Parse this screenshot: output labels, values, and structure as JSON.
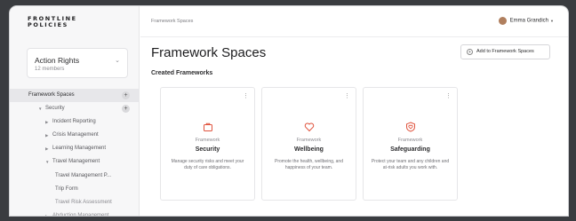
{
  "brand": {
    "logo_line1": "FRONTLINE",
    "logo_line2": "POLICIES"
  },
  "org": {
    "name": "Action Rights",
    "members": "12 members"
  },
  "tree": {
    "framework_spaces": "Framework Spaces",
    "security": "Security",
    "incident_reporting": "Incident Reporting",
    "crisis_management": "Crisis Management",
    "learning_management": "Learning Management",
    "travel_management": "Travel Management",
    "travel_management_p": "Travel Management P...",
    "trip_form": "Trip Form",
    "travel_risk_assessment": "Travel Risk Assessment",
    "abduction_management": "Abduction Management"
  },
  "header": {
    "breadcrumb": "Framework Spaces",
    "user_name": "Emma Grandich"
  },
  "main": {
    "title": "Framework Spaces",
    "add_button": "Add to Framework Spaces",
    "section_title": "Created Frameworks"
  },
  "cards": [
    {
      "kind": "Framework",
      "name": "Security",
      "desc": "Manage security risks and meet your duty of care obligations.",
      "icon": "briefcase-icon"
    },
    {
      "kind": "Framework",
      "name": "Wellbeing",
      "desc": "Promote the health, wellbeing, and happiness of your team.",
      "icon": "heart-icon"
    },
    {
      "kind": "Framework",
      "name": "Safeguarding",
      "desc": "Protect your team and any children and at-risk adults you work with.",
      "icon": "heart-shield-icon"
    }
  ],
  "colors": {
    "accent": "#e0533d"
  }
}
